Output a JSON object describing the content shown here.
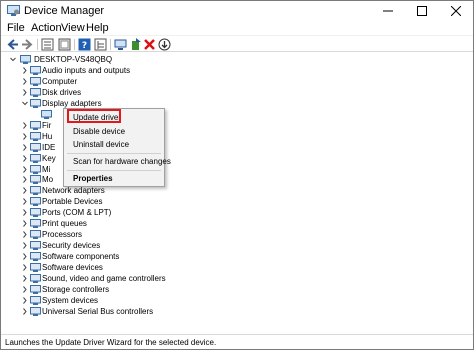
{
  "window": {
    "title": "Device Manager"
  },
  "menu": [
    "File",
    "Action",
    "View",
    "Help"
  ],
  "toolbar": {
    "icons": [
      "back-arrow-icon",
      "forward-arrow-icon",
      "properties-pane-icon",
      "show-hidden-icon",
      "help-icon",
      "device-view-icon",
      "monitor-icon",
      "update-driver-icon",
      "uninstall-x-icon",
      "download-icon"
    ]
  },
  "tree": {
    "root": "DESKTOP-VS48QBQ",
    "categories": [
      "Audio inputs and outputs",
      "Computer",
      "Disk drives",
      "Display adapters",
      "",
      "Fir",
      "Hu",
      "IDE",
      "Key",
      "Mi",
      "Mo",
      "Network adapters",
      "Portable Devices",
      "Ports (COM & LPT)",
      "Print queues",
      "Processors",
      "Security devices",
      "Software components",
      "Software devices",
      "Sound, video and game controllers",
      "Storage controllers",
      "System devices",
      "Universal Serial Bus controllers"
    ]
  },
  "context_menu": {
    "items": [
      "Update driver",
      "Disable device",
      "Uninstall device",
      "Scan for hardware changes",
      "Properties"
    ]
  },
  "status": "Launches the Update Driver Wizard for the selected device.",
  "colors": {
    "highlight_box": "#e3181a",
    "accent": "#0078d7"
  }
}
